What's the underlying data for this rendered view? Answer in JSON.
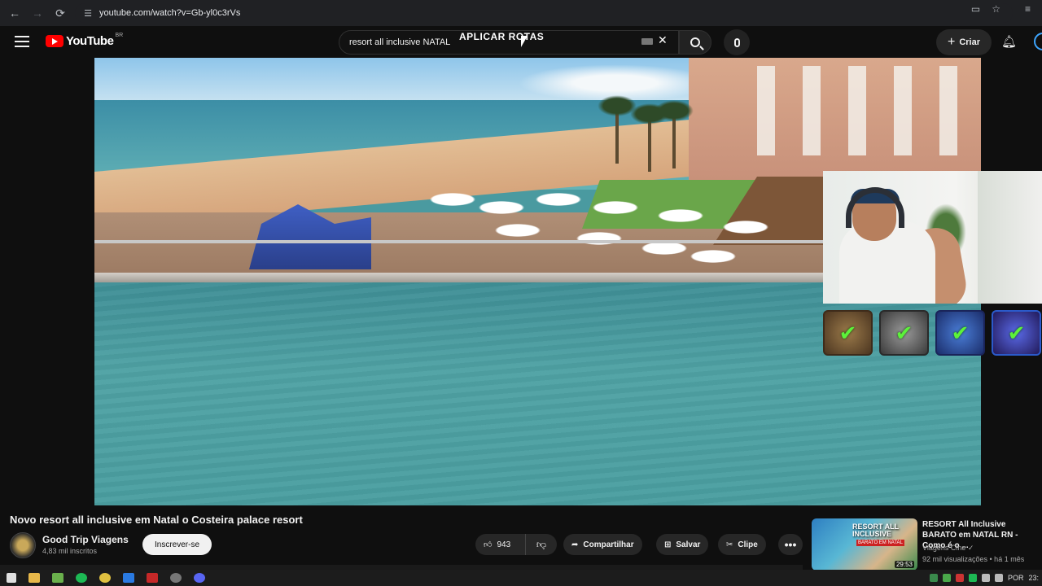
{
  "browser": {
    "url": "youtube.com/watch?v=Gb-yl0c3rVs",
    "back_icon": "arrow-left-icon",
    "forward_icon": "arrow-right-icon",
    "reload_icon": "reload-icon",
    "site_info_icon": "tune-icon",
    "cast_icon": "cast-icon",
    "bookmark_icon": "star-icon",
    "reading_list_icon": "reading-list-icon"
  },
  "header": {
    "logo_text": "YouTube",
    "region": "BR",
    "search_value": "resort all inclusive NATAL",
    "search_overlay_text": "APLICAR ROTAS",
    "create_label": "Criar"
  },
  "video": {
    "title": "Novo resort all inclusive em Natal o Costeira palace resort",
    "badges": [
      "✔",
      "✔",
      "✔",
      "✔"
    ]
  },
  "channel": {
    "name": "Good Trip Viagens",
    "subscribers": "4,83 mil inscritos",
    "subscribe_label": "Inscrever-se"
  },
  "actions": {
    "likes": "943",
    "share_label": "Compartilhar",
    "save_label": "Salvar",
    "clip_label": "Clipe",
    "more_label": "•••"
  },
  "recommendation": {
    "title": "RESORT All Inclusive BARATO em NATAL RN - Como é o ...",
    "channel": "Viagens Cine",
    "meta": "92 mil visualizações • há 1 mês",
    "duration": "29:53",
    "thumb_title": "RESORT ALL INCLUSIVE",
    "thumb_sub": "BARATO EM NATAL"
  },
  "taskbar": {
    "language": "POR",
    "time": "23:"
  },
  "colors": {
    "background": "#0f0f0f",
    "brand_red": "#ff0000",
    "badge_check": "#5cf23a"
  }
}
